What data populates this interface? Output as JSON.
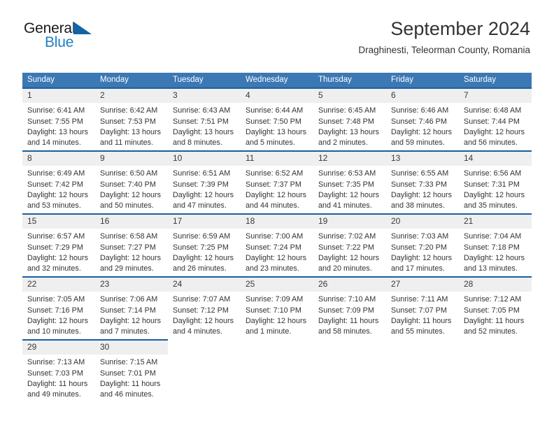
{
  "brand": {
    "logo_line1": "General",
    "logo_line2": "Blue",
    "logo_icon": "triangle-icon",
    "color_dark": "#1a1a1a",
    "color_blue": "#1f7fc4"
  },
  "header": {
    "title": "September 2024",
    "subtitle": "Draghinesti, Teleorman County, Romania"
  },
  "theme": {
    "header_bg": "#3c78b4",
    "cell_top_border": "#1a5fa0",
    "daynum_bg": "#efefef",
    "text": "#333333"
  },
  "weekdays": [
    "Sunday",
    "Monday",
    "Tuesday",
    "Wednesday",
    "Thursday",
    "Friday",
    "Saturday"
  ],
  "weeks": [
    [
      {
        "day": "1",
        "sunrise": "Sunrise: 6:41 AM",
        "sunset": "Sunset: 7:55 PM",
        "daylight1": "Daylight: 13 hours",
        "daylight2": "and 14 minutes."
      },
      {
        "day": "2",
        "sunrise": "Sunrise: 6:42 AM",
        "sunset": "Sunset: 7:53 PM",
        "daylight1": "Daylight: 13 hours",
        "daylight2": "and 11 minutes."
      },
      {
        "day": "3",
        "sunrise": "Sunrise: 6:43 AM",
        "sunset": "Sunset: 7:51 PM",
        "daylight1": "Daylight: 13 hours",
        "daylight2": "and 8 minutes."
      },
      {
        "day": "4",
        "sunrise": "Sunrise: 6:44 AM",
        "sunset": "Sunset: 7:50 PM",
        "daylight1": "Daylight: 13 hours",
        "daylight2": "and 5 minutes."
      },
      {
        "day": "5",
        "sunrise": "Sunrise: 6:45 AM",
        "sunset": "Sunset: 7:48 PM",
        "daylight1": "Daylight: 13 hours",
        "daylight2": "and 2 minutes."
      },
      {
        "day": "6",
        "sunrise": "Sunrise: 6:46 AM",
        "sunset": "Sunset: 7:46 PM",
        "daylight1": "Daylight: 12 hours",
        "daylight2": "and 59 minutes."
      },
      {
        "day": "7",
        "sunrise": "Sunrise: 6:48 AM",
        "sunset": "Sunset: 7:44 PM",
        "daylight1": "Daylight: 12 hours",
        "daylight2": "and 56 minutes."
      }
    ],
    [
      {
        "day": "8",
        "sunrise": "Sunrise: 6:49 AM",
        "sunset": "Sunset: 7:42 PM",
        "daylight1": "Daylight: 12 hours",
        "daylight2": "and 53 minutes."
      },
      {
        "day": "9",
        "sunrise": "Sunrise: 6:50 AM",
        "sunset": "Sunset: 7:40 PM",
        "daylight1": "Daylight: 12 hours",
        "daylight2": "and 50 minutes."
      },
      {
        "day": "10",
        "sunrise": "Sunrise: 6:51 AM",
        "sunset": "Sunset: 7:39 PM",
        "daylight1": "Daylight: 12 hours",
        "daylight2": "and 47 minutes."
      },
      {
        "day": "11",
        "sunrise": "Sunrise: 6:52 AM",
        "sunset": "Sunset: 7:37 PM",
        "daylight1": "Daylight: 12 hours",
        "daylight2": "and 44 minutes."
      },
      {
        "day": "12",
        "sunrise": "Sunrise: 6:53 AM",
        "sunset": "Sunset: 7:35 PM",
        "daylight1": "Daylight: 12 hours",
        "daylight2": "and 41 minutes."
      },
      {
        "day": "13",
        "sunrise": "Sunrise: 6:55 AM",
        "sunset": "Sunset: 7:33 PM",
        "daylight1": "Daylight: 12 hours",
        "daylight2": "and 38 minutes."
      },
      {
        "day": "14",
        "sunrise": "Sunrise: 6:56 AM",
        "sunset": "Sunset: 7:31 PM",
        "daylight1": "Daylight: 12 hours",
        "daylight2": "and 35 minutes."
      }
    ],
    [
      {
        "day": "15",
        "sunrise": "Sunrise: 6:57 AM",
        "sunset": "Sunset: 7:29 PM",
        "daylight1": "Daylight: 12 hours",
        "daylight2": "and 32 minutes."
      },
      {
        "day": "16",
        "sunrise": "Sunrise: 6:58 AM",
        "sunset": "Sunset: 7:27 PM",
        "daylight1": "Daylight: 12 hours",
        "daylight2": "and 29 minutes."
      },
      {
        "day": "17",
        "sunrise": "Sunrise: 6:59 AM",
        "sunset": "Sunset: 7:25 PM",
        "daylight1": "Daylight: 12 hours",
        "daylight2": "and 26 minutes."
      },
      {
        "day": "18",
        "sunrise": "Sunrise: 7:00 AM",
        "sunset": "Sunset: 7:24 PM",
        "daylight1": "Daylight: 12 hours",
        "daylight2": "and 23 minutes."
      },
      {
        "day": "19",
        "sunrise": "Sunrise: 7:02 AM",
        "sunset": "Sunset: 7:22 PM",
        "daylight1": "Daylight: 12 hours",
        "daylight2": "and 20 minutes."
      },
      {
        "day": "20",
        "sunrise": "Sunrise: 7:03 AM",
        "sunset": "Sunset: 7:20 PM",
        "daylight1": "Daylight: 12 hours",
        "daylight2": "and 17 minutes."
      },
      {
        "day": "21",
        "sunrise": "Sunrise: 7:04 AM",
        "sunset": "Sunset: 7:18 PM",
        "daylight1": "Daylight: 12 hours",
        "daylight2": "and 13 minutes."
      }
    ],
    [
      {
        "day": "22",
        "sunrise": "Sunrise: 7:05 AM",
        "sunset": "Sunset: 7:16 PM",
        "daylight1": "Daylight: 12 hours",
        "daylight2": "and 10 minutes."
      },
      {
        "day": "23",
        "sunrise": "Sunrise: 7:06 AM",
        "sunset": "Sunset: 7:14 PM",
        "daylight1": "Daylight: 12 hours",
        "daylight2": "and 7 minutes."
      },
      {
        "day": "24",
        "sunrise": "Sunrise: 7:07 AM",
        "sunset": "Sunset: 7:12 PM",
        "daylight1": "Daylight: 12 hours",
        "daylight2": "and 4 minutes."
      },
      {
        "day": "25",
        "sunrise": "Sunrise: 7:09 AM",
        "sunset": "Sunset: 7:10 PM",
        "daylight1": "Daylight: 12 hours",
        "daylight2": "and 1 minute."
      },
      {
        "day": "26",
        "sunrise": "Sunrise: 7:10 AM",
        "sunset": "Sunset: 7:09 PM",
        "daylight1": "Daylight: 11 hours",
        "daylight2": "and 58 minutes."
      },
      {
        "day": "27",
        "sunrise": "Sunrise: 7:11 AM",
        "sunset": "Sunset: 7:07 PM",
        "daylight1": "Daylight: 11 hours",
        "daylight2": "and 55 minutes."
      },
      {
        "day": "28",
        "sunrise": "Sunrise: 7:12 AM",
        "sunset": "Sunset: 7:05 PM",
        "daylight1": "Daylight: 11 hours",
        "daylight2": "and 52 minutes."
      }
    ],
    [
      {
        "day": "29",
        "sunrise": "Sunrise: 7:13 AM",
        "sunset": "Sunset: 7:03 PM",
        "daylight1": "Daylight: 11 hours",
        "daylight2": "and 49 minutes."
      },
      {
        "day": "30",
        "sunrise": "Sunrise: 7:15 AM",
        "sunset": "Sunset: 7:01 PM",
        "daylight1": "Daylight: 11 hours",
        "daylight2": "and 46 minutes."
      },
      {
        "day": "",
        "sunrise": "",
        "sunset": "",
        "daylight1": "",
        "daylight2": ""
      },
      {
        "day": "",
        "sunrise": "",
        "sunset": "",
        "daylight1": "",
        "daylight2": ""
      },
      {
        "day": "",
        "sunrise": "",
        "sunset": "",
        "daylight1": "",
        "daylight2": ""
      },
      {
        "day": "",
        "sunrise": "",
        "sunset": "",
        "daylight1": "",
        "daylight2": ""
      },
      {
        "day": "",
        "sunrise": "",
        "sunset": "",
        "daylight1": "",
        "daylight2": ""
      }
    ]
  ]
}
